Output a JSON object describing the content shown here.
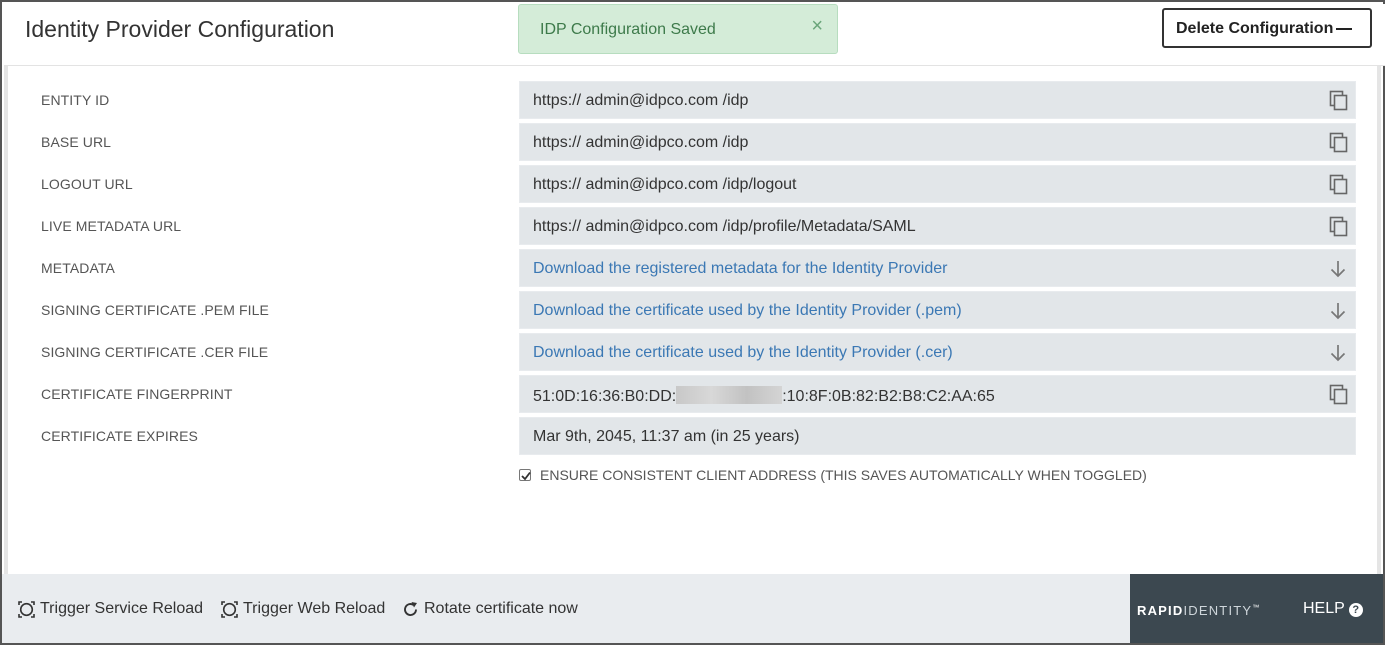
{
  "header": {
    "title": "Identity Provider Configuration",
    "delete_label": "Delete Configuration"
  },
  "toast": {
    "message": "IDP Configuration Saved",
    "close_glyph": "×"
  },
  "rows": [
    {
      "label": "ENTITY ID",
      "value": "https:// admin@idpco.com /idp",
      "action": "copy-icon"
    },
    {
      "label": "BASE URL",
      "value": "https:// admin@idpco.com /idp",
      "action": "copy-icon"
    },
    {
      "label": "LOGOUT URL",
      "value": "https://  admin@idpco.com /idp/logout",
      "action": "copy-icon"
    },
    {
      "label": "LIVE METADATA URL",
      "value": "https://  admin@idpco.com /idp/profile/Metadata/SAML",
      "action": "copy-icon"
    },
    {
      "label": "METADATA",
      "value": "Download the registered metadata for the Identity Provider",
      "action": "download-icon"
    },
    {
      "label": "SIGNING CERTIFICATE .PEM FILE",
      "value": "Download the certificate used by the Identity Provider (.pem)",
      "action": "download-icon"
    },
    {
      "label": "SIGNING CERTIFICATE .CER FILE",
      "value": "Download the certificate used by the Identity Provider (.cer)",
      "action": "download-icon"
    },
    {
      "label": "CERTIFICATE FINGERPRINT",
      "value_prefix": "51:0D:16:36:B0:DD:",
      "value_suffix": ":10:8F:0B:82:B2:B8:C2:AA:65",
      "action": "copy-icon"
    },
    {
      "label": "CERTIFICATE EXPIRES",
      "value": "Mar 9th, 2045, 11:37 am (in 25 years)"
    }
  ],
  "checkbox": {
    "label": "ENSURE CONSISTENT CLIENT ADDRESS (THIS SAVES AUTOMATICALLY WHEN TOGGLED)",
    "checked": true
  },
  "footer": {
    "service_reload": "Trigger Service Reload",
    "web_reload": "Trigger Web Reload",
    "rotate_cert": "Rotate certificate now",
    "brand_bold": "RAPID",
    "brand_light": "IDENTITY",
    "brand_tm": "™",
    "help": "HELP",
    "help_glyph": "?"
  },
  "colors": {
    "toast_bg": "#d4ecd8",
    "toast_text": "#3d7a4a",
    "field_bg": "#e2e6e9",
    "link": "#3b78b4",
    "footer_bg": "#e9ecef",
    "brand_panel": "#3c4850"
  }
}
